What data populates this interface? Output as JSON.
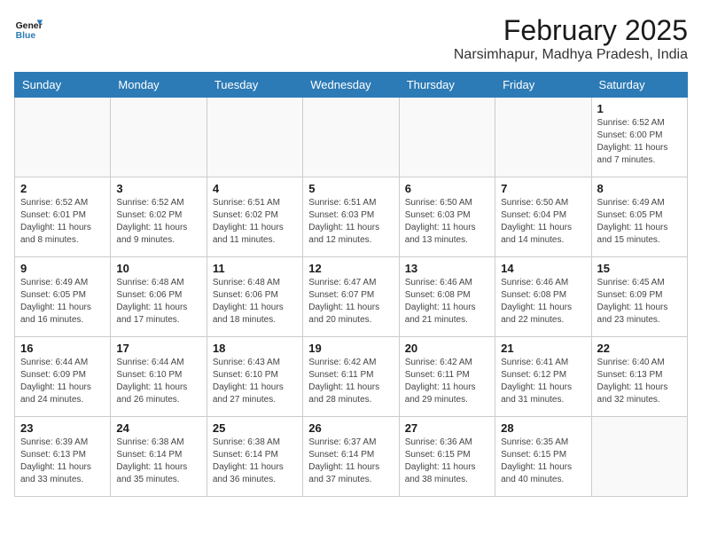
{
  "header": {
    "logo_line1": "General",
    "logo_line2": "Blue",
    "month_year": "February 2025",
    "location": "Narsimhapur, Madhya Pradesh, India"
  },
  "weekdays": [
    "Sunday",
    "Monday",
    "Tuesday",
    "Wednesday",
    "Thursday",
    "Friday",
    "Saturday"
  ],
  "weeks": [
    [
      {
        "day": "",
        "info": ""
      },
      {
        "day": "",
        "info": ""
      },
      {
        "day": "",
        "info": ""
      },
      {
        "day": "",
        "info": ""
      },
      {
        "day": "",
        "info": ""
      },
      {
        "day": "",
        "info": ""
      },
      {
        "day": "1",
        "info": "Sunrise: 6:52 AM\nSunset: 6:00 PM\nDaylight: 11 hours\nand 7 minutes."
      }
    ],
    [
      {
        "day": "2",
        "info": "Sunrise: 6:52 AM\nSunset: 6:01 PM\nDaylight: 11 hours\nand 8 minutes."
      },
      {
        "day": "3",
        "info": "Sunrise: 6:52 AM\nSunset: 6:02 PM\nDaylight: 11 hours\nand 9 minutes."
      },
      {
        "day": "4",
        "info": "Sunrise: 6:51 AM\nSunset: 6:02 PM\nDaylight: 11 hours\nand 11 minutes."
      },
      {
        "day": "5",
        "info": "Sunrise: 6:51 AM\nSunset: 6:03 PM\nDaylight: 11 hours\nand 12 minutes."
      },
      {
        "day": "6",
        "info": "Sunrise: 6:50 AM\nSunset: 6:03 PM\nDaylight: 11 hours\nand 13 minutes."
      },
      {
        "day": "7",
        "info": "Sunrise: 6:50 AM\nSunset: 6:04 PM\nDaylight: 11 hours\nand 14 minutes."
      },
      {
        "day": "8",
        "info": "Sunrise: 6:49 AM\nSunset: 6:05 PM\nDaylight: 11 hours\nand 15 minutes."
      }
    ],
    [
      {
        "day": "9",
        "info": "Sunrise: 6:49 AM\nSunset: 6:05 PM\nDaylight: 11 hours\nand 16 minutes."
      },
      {
        "day": "10",
        "info": "Sunrise: 6:48 AM\nSunset: 6:06 PM\nDaylight: 11 hours\nand 17 minutes."
      },
      {
        "day": "11",
        "info": "Sunrise: 6:48 AM\nSunset: 6:06 PM\nDaylight: 11 hours\nand 18 minutes."
      },
      {
        "day": "12",
        "info": "Sunrise: 6:47 AM\nSunset: 6:07 PM\nDaylight: 11 hours\nand 20 minutes."
      },
      {
        "day": "13",
        "info": "Sunrise: 6:46 AM\nSunset: 6:08 PM\nDaylight: 11 hours\nand 21 minutes."
      },
      {
        "day": "14",
        "info": "Sunrise: 6:46 AM\nSunset: 6:08 PM\nDaylight: 11 hours\nand 22 minutes."
      },
      {
        "day": "15",
        "info": "Sunrise: 6:45 AM\nSunset: 6:09 PM\nDaylight: 11 hours\nand 23 minutes."
      }
    ],
    [
      {
        "day": "16",
        "info": "Sunrise: 6:44 AM\nSunset: 6:09 PM\nDaylight: 11 hours\nand 24 minutes."
      },
      {
        "day": "17",
        "info": "Sunrise: 6:44 AM\nSunset: 6:10 PM\nDaylight: 11 hours\nand 26 minutes."
      },
      {
        "day": "18",
        "info": "Sunrise: 6:43 AM\nSunset: 6:10 PM\nDaylight: 11 hours\nand 27 minutes."
      },
      {
        "day": "19",
        "info": "Sunrise: 6:42 AM\nSunset: 6:11 PM\nDaylight: 11 hours\nand 28 minutes."
      },
      {
        "day": "20",
        "info": "Sunrise: 6:42 AM\nSunset: 6:11 PM\nDaylight: 11 hours\nand 29 minutes."
      },
      {
        "day": "21",
        "info": "Sunrise: 6:41 AM\nSunset: 6:12 PM\nDaylight: 11 hours\nand 31 minutes."
      },
      {
        "day": "22",
        "info": "Sunrise: 6:40 AM\nSunset: 6:13 PM\nDaylight: 11 hours\nand 32 minutes."
      }
    ],
    [
      {
        "day": "23",
        "info": "Sunrise: 6:39 AM\nSunset: 6:13 PM\nDaylight: 11 hours\nand 33 minutes."
      },
      {
        "day": "24",
        "info": "Sunrise: 6:38 AM\nSunset: 6:14 PM\nDaylight: 11 hours\nand 35 minutes."
      },
      {
        "day": "25",
        "info": "Sunrise: 6:38 AM\nSunset: 6:14 PM\nDaylight: 11 hours\nand 36 minutes."
      },
      {
        "day": "26",
        "info": "Sunrise: 6:37 AM\nSunset: 6:14 PM\nDaylight: 11 hours\nand 37 minutes."
      },
      {
        "day": "27",
        "info": "Sunrise: 6:36 AM\nSunset: 6:15 PM\nDaylight: 11 hours\nand 38 minutes."
      },
      {
        "day": "28",
        "info": "Sunrise: 6:35 AM\nSunset: 6:15 PM\nDaylight: 11 hours\nand 40 minutes."
      },
      {
        "day": "",
        "info": ""
      }
    ]
  ]
}
